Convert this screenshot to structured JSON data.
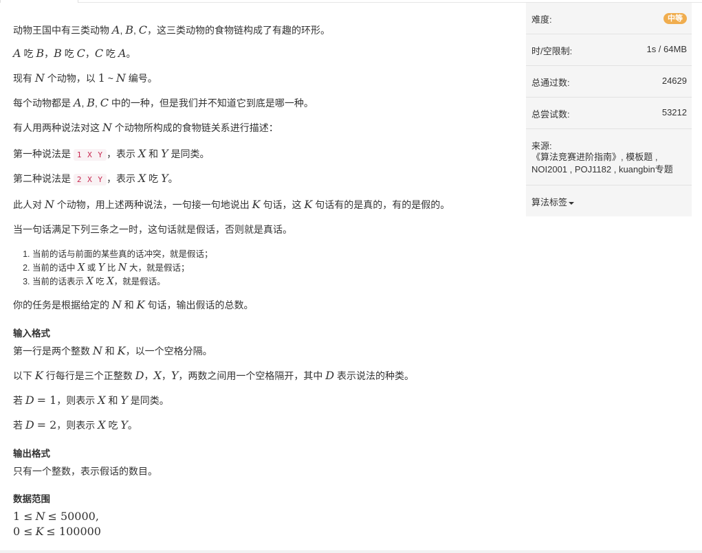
{
  "problem": {
    "intro": "动物王国中有三类动物 A, B, C，这三类动物的食物链构成了有趣的环形。",
    "intro2": "A 吃 B，B 吃 C，C 吃 A。",
    "p_count": "现有 N 个动物，以 1 ~ N 编号。",
    "p_each": "每个动物都是 A, B, C 中的一种，但是我们并不知道它到底是哪一种。",
    "p_describe": "有人用两种说法对这 N 个动物所构成的食物链关系进行描述：",
    "p_first": {
      "pre": "第一种说法是",
      "code": "1 X Y",
      "post": "，表示 X 和 Y 是同类。"
    },
    "p_second": {
      "pre": "第二种说法是",
      "code": "2 X Y",
      "post": "，表示 X 吃 Y。"
    },
    "p_person": "此人对 N 个动物，用上述两种说法，一句接一句地说出 K 句话，这 K 句话有的是真的，有的是假的。",
    "p_rule": "当一句话满足下列三条之一时，这句话就是假话，否则就是真话。",
    "conditions": [
      "当前的话与前面的某些真的话冲突，就是假话；",
      "当前的话中 X 或 Y 比 N 大，就是假话；",
      "当前的话表示 X 吃 X，就是假话。"
    ],
    "p_task": "你的任务是根据给定的 N 和 K 句话，输出假话的总数。",
    "input_heading": "输入格式",
    "input_1": "第一行是两个整数 N 和 K，以一个空格分隔。",
    "input_2": "以下 K 行每行是三个正整数 D，X，Y，两数之间用一个空格隔开，其中 D 表示说法的种类。",
    "input_3": "若 D = 1，则表示 X 和 Y 是同类。",
    "input_4": "若 D = 2，则表示 X 吃 Y。",
    "output_heading": "输出格式",
    "output_1": "只有一个整数，表示假话的数目。",
    "range_heading": "数据范围",
    "range_1": "1 ≤ N ≤ 50000,",
    "range_2": "0 ≤ K ≤ 100000"
  },
  "sidebar": {
    "difficulty_label": "难度:",
    "difficulty_value": "中等",
    "limit_label": "时/空限制:",
    "limit_value": "1s / 64MB",
    "passed_label": "总通过数:",
    "passed_value": "24629",
    "tried_label": "总尝试数:",
    "tried_value": "53212",
    "source_label": "来源:",
    "source_value": "《算法竞赛进阶指南》, 模板题 , NOI2001 , POJ1182 , kuangbin专题",
    "tags_label": "算法标签"
  },
  "colors": {
    "badge": "#f0ad4e",
    "code_text": "#c7254e",
    "code_bg": "#f9f2f4",
    "sidebar_bg": "#f5f5f5"
  }
}
